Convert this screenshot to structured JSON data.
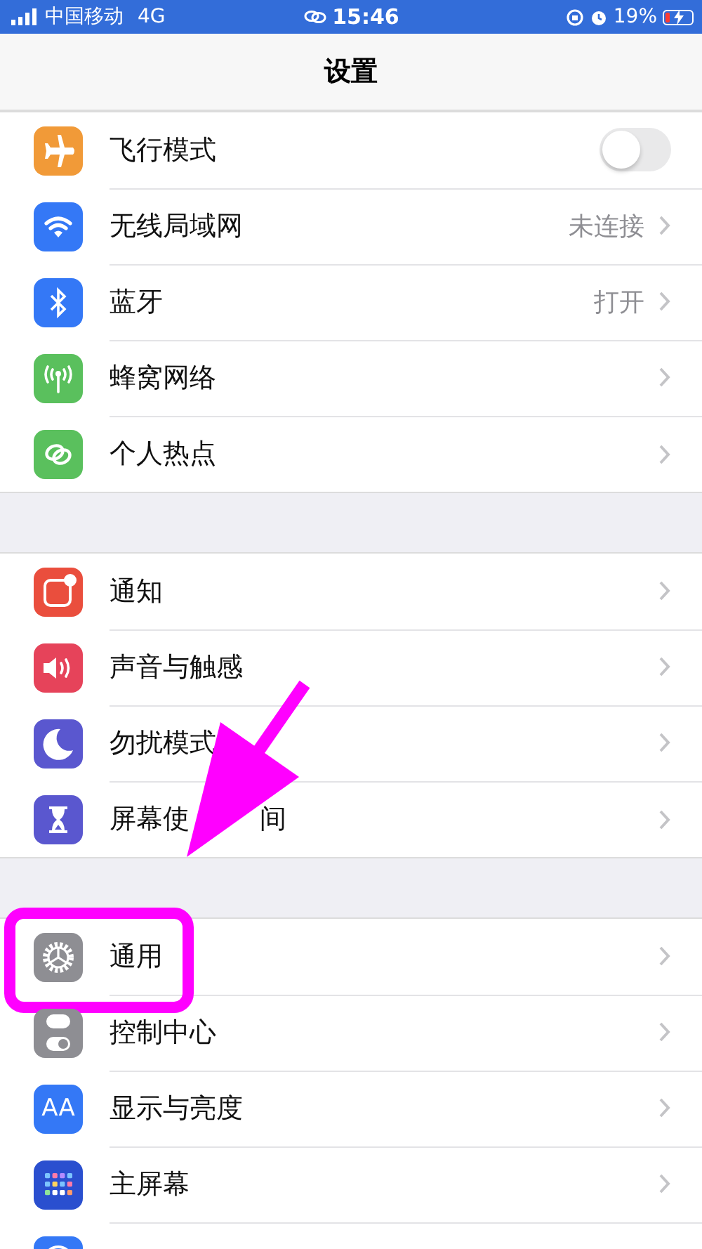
{
  "status_bar": {
    "carrier": "中国移动",
    "network": "4G",
    "time": "15:46",
    "battery_percent": "19%",
    "battery": {
      "level": 0.19,
      "charging": true
    }
  },
  "nav": {
    "title": "设置"
  },
  "groups": [
    {
      "rows": [
        {
          "color": "#f19a38",
          "label": "飞行模式",
          "kind": "toggle",
          "on": false
        },
        {
          "color": "#3478f6",
          "label": "无线局域网",
          "kind": "link",
          "value": "未连接"
        },
        {
          "color": "#3478f6",
          "label": "蓝牙",
          "kind": "link",
          "value": "打开"
        },
        {
          "color": "#5ac05d",
          "label": "蜂窝网络",
          "kind": "link"
        },
        {
          "color": "#5ac05d",
          "label": "个人热点",
          "kind": "link"
        }
      ]
    },
    {
      "rows": [
        {
          "color": "#ea4e3d",
          "label": "通知",
          "kind": "link"
        },
        {
          "color": "#e6435a",
          "label": "声音与触感",
          "kind": "link"
        },
        {
          "color": "#5a57cf",
          "label": "勿扰模式",
          "kind": "link"
        },
        {
          "color": "#5a57cf",
          "label": "屏幕使",
          "label_tail": "间",
          "kind": "link"
        }
      ]
    },
    {
      "rows": [
        {
          "color": "#8e8e93",
          "label": "通用",
          "kind": "link",
          "highlighted": true
        },
        {
          "color": "#8e8e93",
          "label": "控制中心",
          "kind": "link"
        },
        {
          "icon_text": "AA",
          "color": "#3478f6",
          "label": "显示与亮度",
          "kind": "link"
        },
        {
          "color": "#2a4fcf",
          "label": "主屏幕",
          "kind": "link"
        },
        {
          "color": "#3478f6",
          "kind": "partial"
        }
      ]
    }
  ],
  "annotations": [
    {
      "kind": "arrow"
    }
  ]
}
